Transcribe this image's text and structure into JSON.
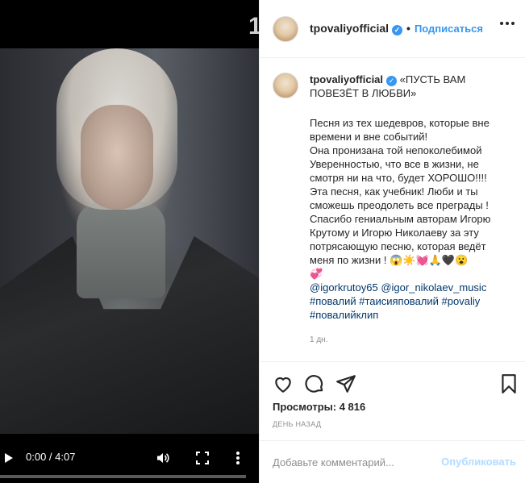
{
  "video": {
    "time": "0:00 / 4:07",
    "progress": 0,
    "top_digit": "1"
  },
  "header": {
    "username": "tpovaliyofficial",
    "dot": "•",
    "follow_label": "Подписаться"
  },
  "caption": {
    "username": "tpovaliyofficial",
    "title": "«ПУСТЬ ВАМ ПОВЕЗЁТ В ЛЮБВИ»",
    "body": "Песня из тех шедевров, которые вне времени и вне событий!\nОна пронизана той непоколебимой Уверенностью, что все в жизни, не смотря ни на что, будет ХОРОШО!!!!\nЭта песня, как учебник! Люби и ты сможешь преодолеть все преграды !\nСпасибо гениальным авторам Игорю Крутому и Игорю Николаеву за эту потрясающую песню, которая ведёт меня по жизни ! 😱☀️💓🙏🖤😮\n💞",
    "mentions": "@igorkrutoy65 @igor_nikolaev_music",
    "tags_line1": "#повалий #таисияповалий #povaliy",
    "tags_line2": "#повалийклип",
    "time_ago": "1 дн."
  },
  "stats": {
    "views_label": "Просмотры:",
    "views_count": "4 816",
    "posted": "ДЕНЬ НАЗАД"
  },
  "comment": {
    "placeholder": "Добавьте комментарий...",
    "publish_label": "Опубликовать"
  },
  "icons": {
    "like": "heart-icon",
    "comment": "comment-icon",
    "share": "share-icon",
    "save": "bookmark-icon"
  },
  "colors": {
    "accent": "#3897f0",
    "publish_disabled": "#b3dbff",
    "hashtag": "#00376b"
  }
}
